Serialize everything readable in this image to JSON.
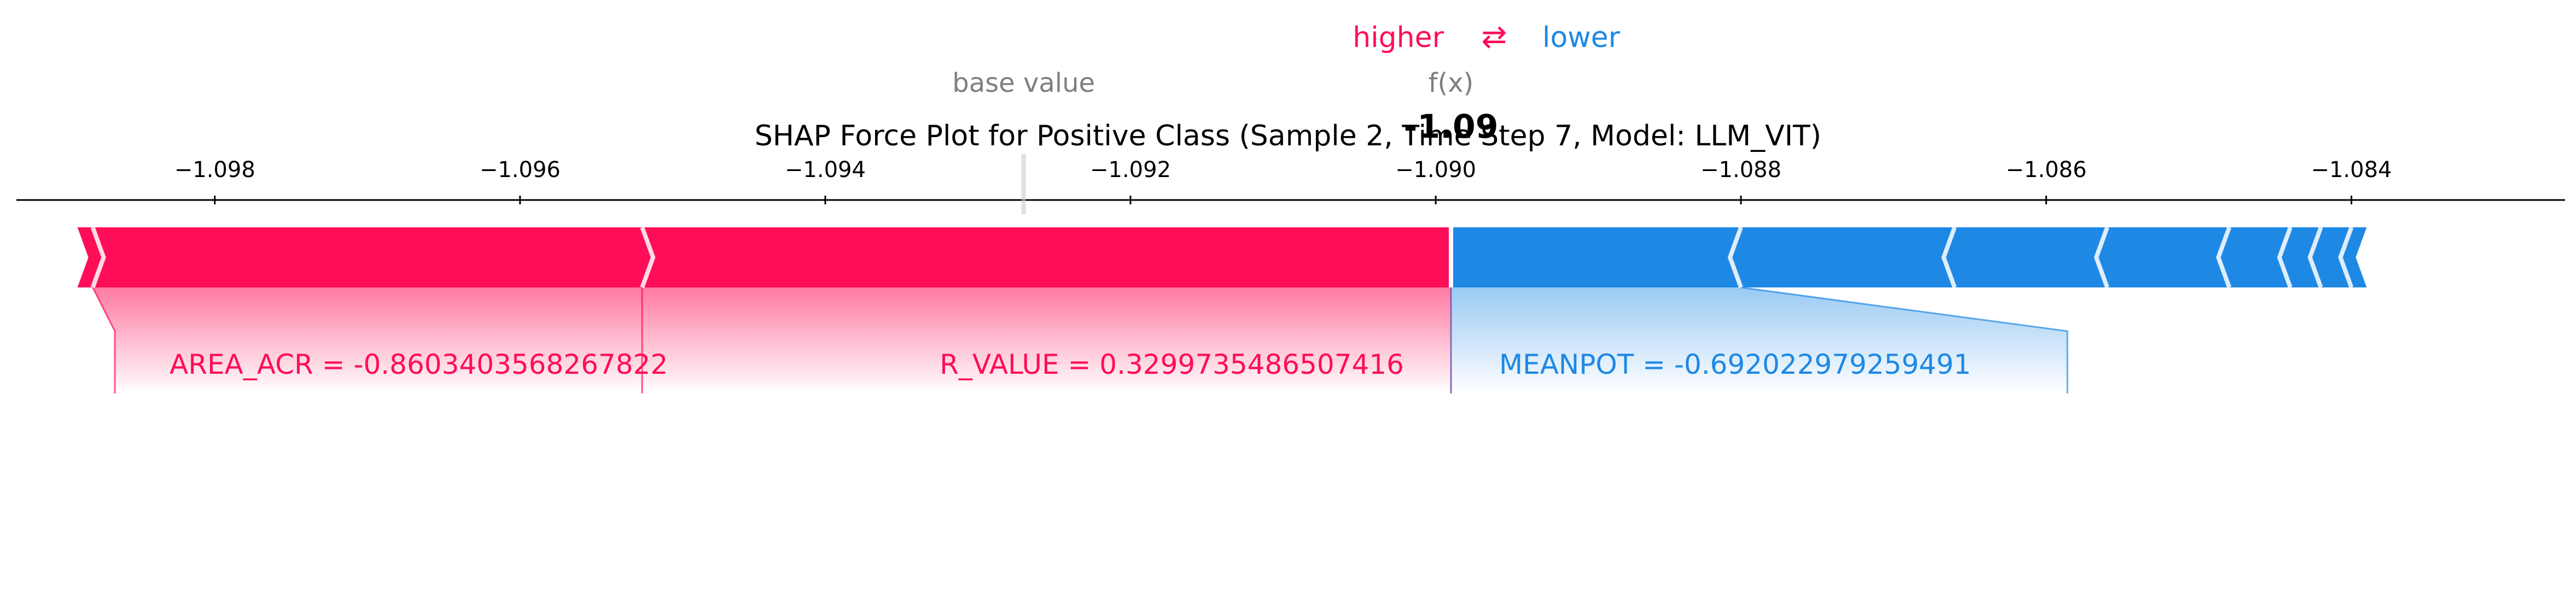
{
  "chart_data": {
    "type": "force",
    "title": "SHAP Force Plot for Positive Class (Sample 2, Time Step 7, Model: LLM_VIT)",
    "legend": {
      "higher": "higher",
      "arrow": "⇄",
      "lower": "lower"
    },
    "base_value_label": "base value",
    "fx_label": "f(x)",
    "fx_value_text": "-1.09",
    "base_value": -1.0927,
    "fx_value": -1.0899,
    "xlim": [
      -1.0993,
      -1.0826
    ],
    "ticks": [
      {
        "value": -1.098,
        "label": "−1.098"
      },
      {
        "value": -1.096,
        "label": "−1.096"
      },
      {
        "value": -1.094,
        "label": "−1.094"
      },
      {
        "value": -1.092,
        "label": "−1.092"
      },
      {
        "value": -1.09,
        "label": "−1.090"
      },
      {
        "value": -1.088,
        "label": "−1.088"
      },
      {
        "value": -1.086,
        "label": "−1.086"
      },
      {
        "value": -1.084,
        "label": "−1.084"
      }
    ],
    "positive": [
      {
        "from": -1.0952,
        "to": -1.0899,
        "label": "R_VALUE = 0.3299735486507416"
      },
      {
        "from": -1.0988,
        "to": -1.0952,
        "label": "AREA_ACR = -0.8603403568267822"
      },
      {
        "from": -1.0989,
        "to": -1.0988,
        "label": ""
      }
    ],
    "negative": [
      {
        "from": -1.0899,
        "to": -1.088,
        "label": "MEANPOT = -0.692022979259491"
      },
      {
        "from": -1.088,
        "to": -1.0866,
        "label": ""
      },
      {
        "from": -1.0866,
        "to": -1.0856,
        "label": ""
      },
      {
        "from": -1.0856,
        "to": -1.0848,
        "label": ""
      },
      {
        "from": -1.0848,
        "to": -1.0844,
        "label": ""
      },
      {
        "from": -1.0844,
        "to": -1.0842,
        "label": ""
      },
      {
        "from": -1.0842,
        "to": -1.084,
        "label": ""
      },
      {
        "from": -1.084,
        "to": -1.0839,
        "label": ""
      }
    ],
    "colors": {
      "positive": "#ff0d57",
      "negative": "#1e88e5",
      "axis": "#000000",
      "muted": "#7f7f7f"
    }
  }
}
